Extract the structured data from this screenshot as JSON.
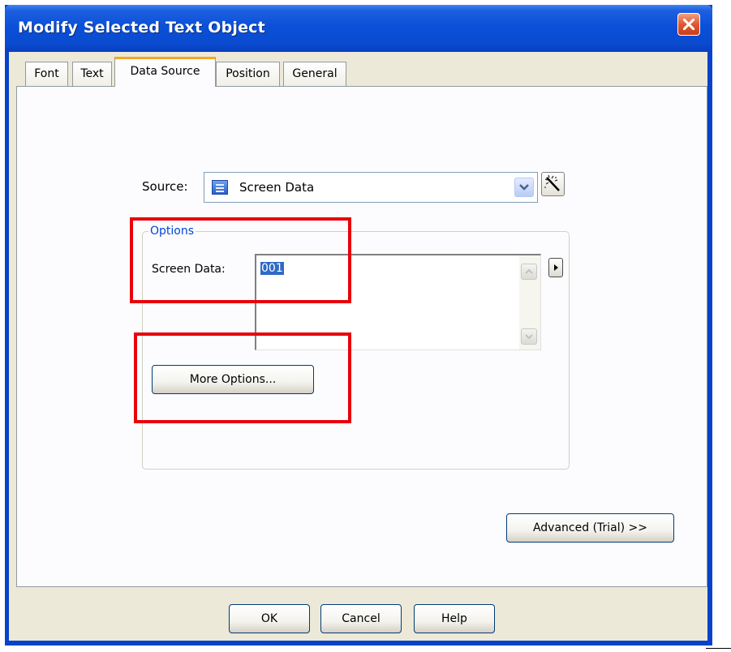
{
  "window": {
    "title": "Modify Selected Text Object",
    "close_icon": "close-x-icon"
  },
  "tabs": [
    {
      "label": "Font",
      "active": false
    },
    {
      "label": "Text",
      "active": false
    },
    {
      "label": "Data Source",
      "active": true
    },
    {
      "label": "Position",
      "active": false
    },
    {
      "label": "General",
      "active": false
    }
  ],
  "source": {
    "label": "Source:",
    "value": "Screen Data",
    "icon": "screen-data-icon",
    "dropdown_icon": "chevron-down-icon",
    "wizard_icon": "magic-wand-icon"
  },
  "options": {
    "legend": "Options",
    "screen_data_label": "Screen Data:",
    "screen_data_value": "001",
    "more_options_label": "More Options...",
    "expand_icon": "play-arrow-icon"
  },
  "advanced_label": "Advanced (Trial) >>",
  "footer": {
    "ok_label": "OK",
    "cancel_label": "Cancel",
    "help_label": "Help"
  },
  "colors": {
    "title_bar": "#0a50d8",
    "annotation_red": "#e8000c",
    "active_tab_accent": "#f7a722",
    "group_legend": "#0046d5",
    "selection": "#316ac5"
  }
}
